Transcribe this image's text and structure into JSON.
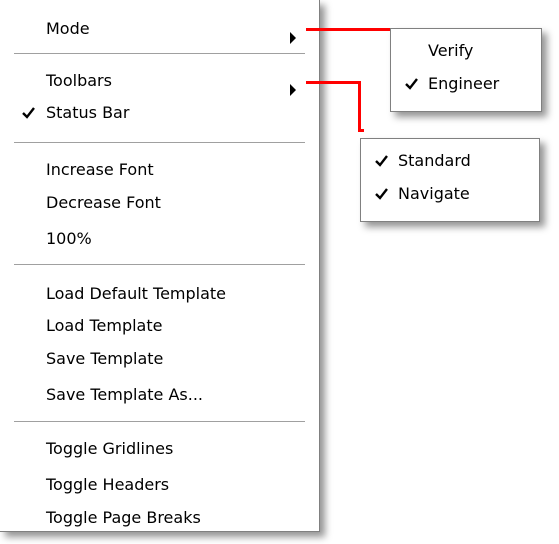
{
  "main_menu": {
    "items": [
      {
        "label": "Mode",
        "checked": false,
        "submenu": true
      },
      {
        "label": "Toolbars",
        "checked": false,
        "submenu": true
      },
      {
        "label": "Status Bar",
        "checked": true,
        "submenu": false
      },
      {
        "label": "Increase Font",
        "checked": false,
        "submenu": false
      },
      {
        "label": "Decrease Font",
        "checked": false,
        "submenu": false
      },
      {
        "label": "100%",
        "checked": false,
        "submenu": false
      },
      {
        "label": "Load Default Template",
        "checked": false,
        "submenu": false
      },
      {
        "label": "Load Template",
        "checked": false,
        "submenu": false
      },
      {
        "label": "Save Template",
        "checked": false,
        "submenu": false
      },
      {
        "label": "Save Template As...",
        "checked": false,
        "submenu": false
      },
      {
        "label": "Toggle Gridlines",
        "checked": false,
        "submenu": false
      },
      {
        "label": "Toggle Headers",
        "checked": false,
        "submenu": false
      },
      {
        "label": "Toggle Page Breaks",
        "checked": false,
        "submenu": false
      }
    ]
  },
  "mode_submenu": {
    "items": [
      {
        "label": "Verify",
        "checked": false
      },
      {
        "label": "Engineer",
        "checked": true
      }
    ]
  },
  "toolbars_submenu": {
    "items": [
      {
        "label": "Standard",
        "checked": true
      },
      {
        "label": "Navigate",
        "checked": true
      }
    ]
  },
  "colors": {
    "connector": "#ff0000",
    "menu_background": "#ffffff",
    "separator": "#a0a0a0"
  },
  "icons": {
    "check": "checkmark-icon",
    "arrow": "submenu-arrow-icon"
  }
}
